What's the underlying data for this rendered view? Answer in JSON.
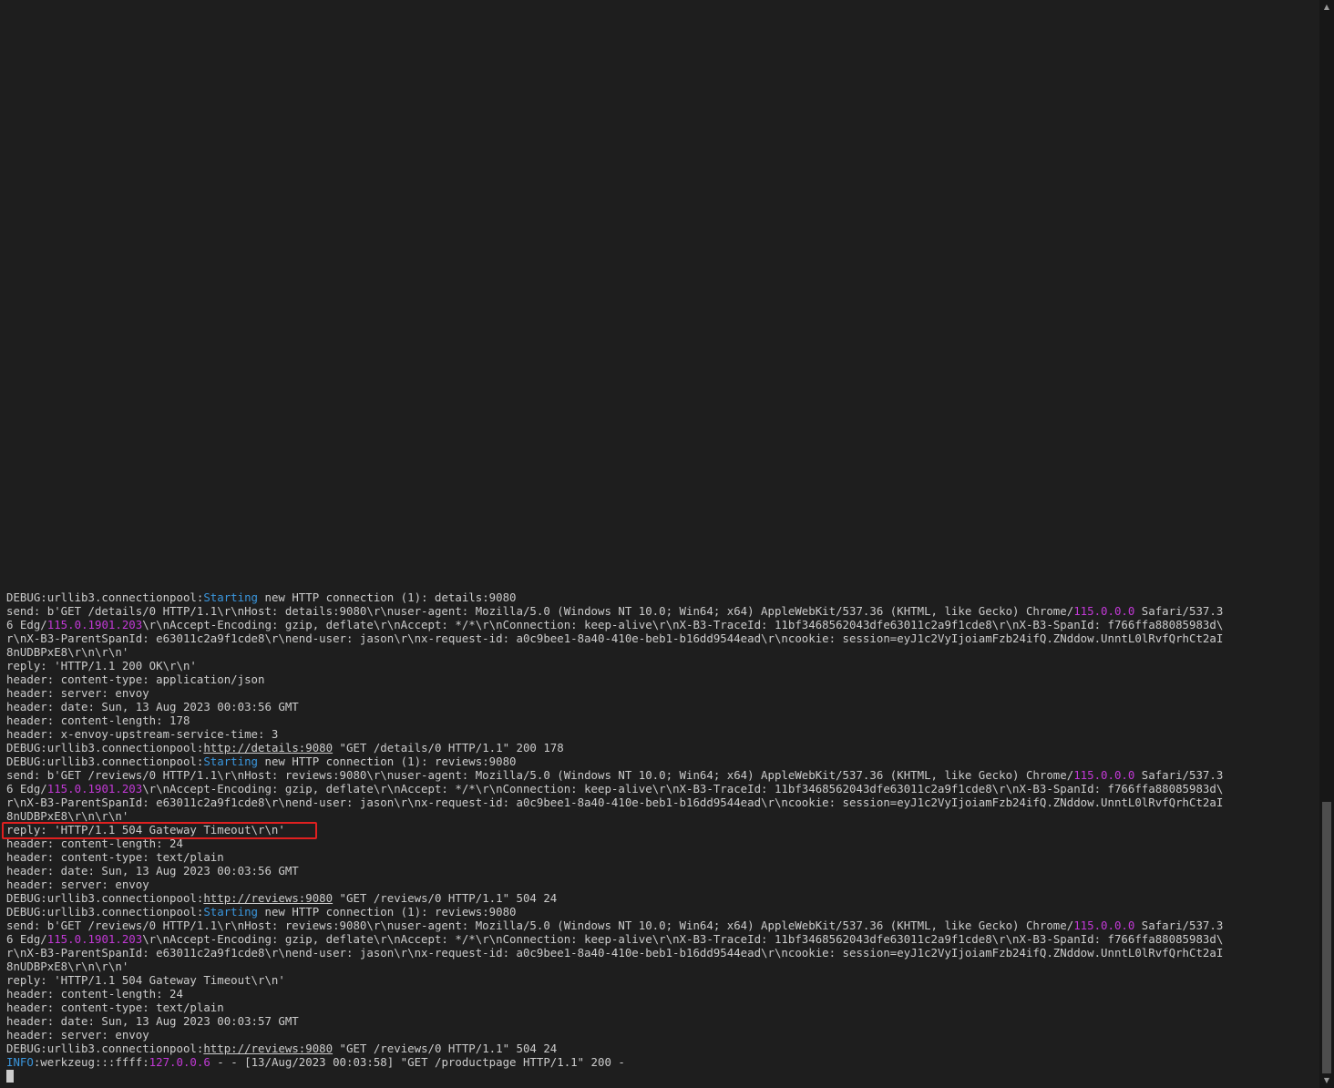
{
  "colors": {
    "background": "#1e1e1e",
    "text": "#cccccc",
    "cyan": "#3a96dd",
    "magenta": "#c239d6",
    "highlight": "#e02020"
  },
  "terminal": {
    "lines": [
      [
        {
          "t": "DEBUG:urllib3.connectionpool:"
        },
        {
          "t": "Starting",
          "c": "cyan"
        },
        {
          "t": " new HTTP connection (1): details:9080"
        }
      ],
      [
        {
          "t": "send: b'GET /details/0 HTTP/1.1\\r\\nHost: details:9080\\r\\nuser-agent: Mozilla/5.0 (Windows NT 10.0; Win64; x64) AppleWebKit/537.36 (KHTML, like Gecko) Chrome/"
        },
        {
          "t": "115.0.0.0",
          "c": "magenta"
        },
        {
          "t": " Safari/537.3"
        }
      ],
      [
        {
          "t": "6 Edg/"
        },
        {
          "t": "115.0.1901.203",
          "c": "magenta"
        },
        {
          "t": "\\r\\nAccept-Encoding: gzip, deflate\\r\\nAccept: */*\\r\\nConnection: keep-alive\\r\\nX-B3-TraceId: 11bf3468562043dfe63011c2a9f1cde8\\r\\nX-B3-SpanId: f766ffa88085983d\\"
        }
      ],
      [
        {
          "t": "r\\nX-B3-ParentSpanId: e63011c2a9f1cde8\\r\\nend-user: jason\\r\\nx-request-id: a0c9bee1-8a40-410e-beb1-b16dd9544ead\\r\\ncookie: session=eyJ1c2VyIjoiamFzb24ifQ.ZNddow.UnntL0lRvfQrhCt2aI"
        }
      ],
      [
        {
          "t": "8nUDBPxE8\\r\\n\\r\\n'"
        }
      ],
      [
        {
          "t": "reply: 'HTTP/1.1 200 OK\\r\\n'"
        }
      ],
      [
        {
          "t": "header: content-type: application/json"
        }
      ],
      [
        {
          "t": "header: server: envoy"
        }
      ],
      [
        {
          "t": "header: date: Sun, 13 Aug 2023 00:03:56 GMT"
        }
      ],
      [
        {
          "t": "header: content-length: 178"
        }
      ],
      [
        {
          "t": "header: x-envoy-upstream-service-time: 3"
        }
      ],
      [
        {
          "t": "DEBUG:urllib3.connectionpool:"
        },
        {
          "t": "http://details:9080",
          "c": "link"
        },
        {
          "t": " \"GET /details/0 HTTP/1.1\" 200 178"
        }
      ],
      [
        {
          "t": "DEBUG:urllib3.connectionpool:"
        },
        {
          "t": "Starting",
          "c": "cyan"
        },
        {
          "t": " new HTTP connection (1): reviews:9080"
        }
      ],
      [
        {
          "t": "send: b'GET /reviews/0 HTTP/1.1\\r\\nHost: reviews:9080\\r\\nuser-agent: Mozilla/5.0 (Windows NT 10.0; Win64; x64) AppleWebKit/537.36 (KHTML, like Gecko) Chrome/"
        },
        {
          "t": "115.0.0.0",
          "c": "magenta"
        },
        {
          "t": " Safari/537.3"
        }
      ],
      [
        {
          "t": "6 Edg/"
        },
        {
          "t": "115.0.1901.203",
          "c": "magenta"
        },
        {
          "t": "\\r\\nAccept-Encoding: gzip, deflate\\r\\nAccept: */*\\r\\nConnection: keep-alive\\r\\nX-B3-TraceId: 11bf3468562043dfe63011c2a9f1cde8\\r\\nX-B3-SpanId: f766ffa88085983d\\"
        }
      ],
      [
        {
          "t": "r\\nX-B3-ParentSpanId: e63011c2a9f1cde8\\r\\nend-user: jason\\r\\nx-request-id: a0c9bee1-8a40-410e-beb1-b16dd9544ead\\r\\ncookie: session=eyJ1c2VyIjoiamFzb24ifQ.ZNddow.UnntL0lRvfQrhCt2aI"
        }
      ],
      [
        {
          "t": "8nUDBPxE8\\r\\n\\r\\n'"
        }
      ],
      [
        {
          "t": "reply: 'HTTP/1.1 504 Gateway Timeout\\r\\n'"
        }
      ],
      [
        {
          "t": "header: content-length: 24"
        }
      ],
      [
        {
          "t": "header: content-type: text/plain"
        }
      ],
      [
        {
          "t": "header: date: Sun, 13 Aug 2023 00:03:56 GMT"
        }
      ],
      [
        {
          "t": "header: server: envoy"
        }
      ],
      [
        {
          "t": "DEBUG:urllib3.connectionpool:"
        },
        {
          "t": "http://reviews:9080",
          "c": "link"
        },
        {
          "t": " \"GET /reviews/0 HTTP/1.1\" 504 24"
        }
      ],
      [
        {
          "t": "DEBUG:urllib3.connectionpool:"
        },
        {
          "t": "Starting",
          "c": "cyan"
        },
        {
          "t": " new HTTP connection (1): reviews:9080"
        }
      ],
      [
        {
          "t": "send: b'GET /reviews/0 HTTP/1.1\\r\\nHost: reviews:9080\\r\\nuser-agent: Mozilla/5.0 (Windows NT 10.0; Win64; x64) AppleWebKit/537.36 (KHTML, like Gecko) Chrome/"
        },
        {
          "t": "115.0.0.0",
          "c": "magenta"
        },
        {
          "t": " Safari/537.3"
        }
      ],
      [
        {
          "t": "6 Edg/"
        },
        {
          "t": "115.0.1901.203",
          "c": "magenta"
        },
        {
          "t": "\\r\\nAccept-Encoding: gzip, deflate\\r\\nAccept: */*\\r\\nConnection: keep-alive\\r\\nX-B3-TraceId: 11bf3468562043dfe63011c2a9f1cde8\\r\\nX-B3-SpanId: f766ffa88085983d\\"
        }
      ],
      [
        {
          "t": "r\\nX-B3-ParentSpanId: e63011c2a9f1cde8\\r\\nend-user: jason\\r\\nx-request-id: a0c9bee1-8a40-410e-beb1-b16dd9544ead\\r\\ncookie: session=eyJ1c2VyIjoiamFzb24ifQ.ZNddow.UnntL0lRvfQrhCt2aI"
        }
      ],
      [
        {
          "t": "8nUDBPxE8\\r\\n\\r\\n'"
        }
      ],
      [
        {
          "t": "reply: 'HTTP/1.1 504 Gateway Timeout\\r\\n'"
        }
      ],
      [
        {
          "t": "header: content-length: 24"
        }
      ],
      [
        {
          "t": "header: content-type: text/plain"
        }
      ],
      [
        {
          "t": "header: date: Sun, 13 Aug 2023 00:03:57 GMT"
        }
      ],
      [
        {
          "t": "header: server: envoy"
        }
      ],
      [
        {
          "t": "DEBUG:urllib3.connectionpool:"
        },
        {
          "t": "http://reviews:9080",
          "c": "link"
        },
        {
          "t": " \"GET /reviews/0 HTTP/1.1\" 504 24"
        }
      ],
      [
        {
          "t": "INFO",
          "c": "cyan"
        },
        {
          "t": ":werkzeug:::ffff:"
        },
        {
          "t": "127.0.0.6",
          "c": "magenta"
        },
        {
          "t": " - - [13/Aug/2023 00:03:58] \"GET /productpage HTTP/1.1\" 200 -"
        }
      ]
    ],
    "highlighted_line_index": 17
  },
  "scrollbar": {
    "up_icon": "▲",
    "down_icon": "▼"
  }
}
